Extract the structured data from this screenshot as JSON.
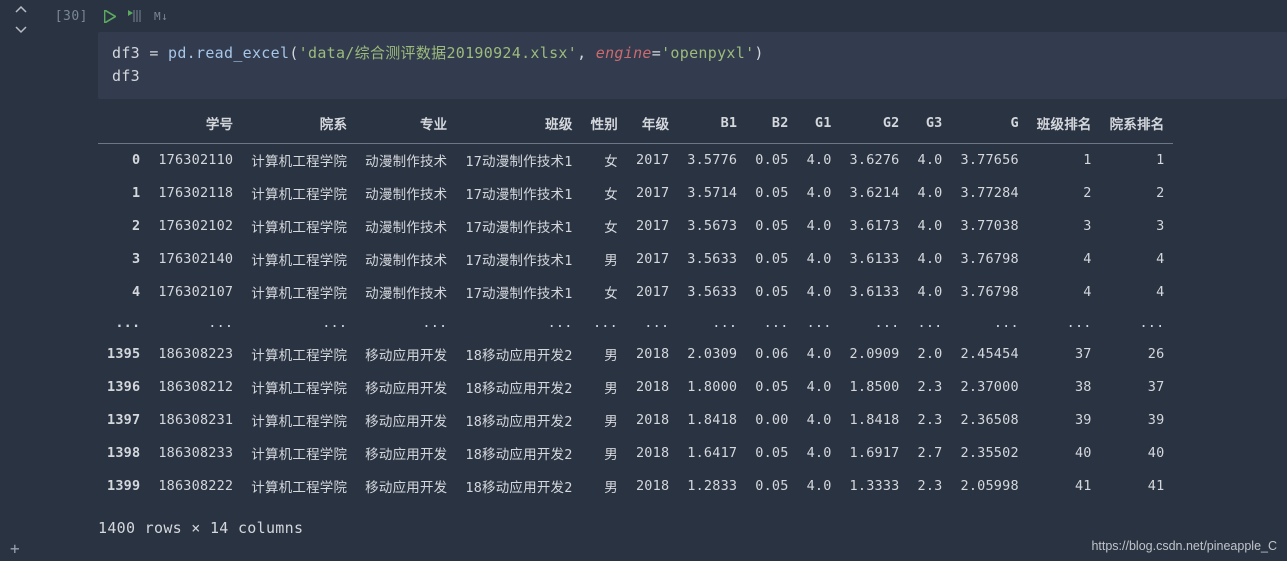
{
  "cell": {
    "exec_count": "[30]",
    "toolbar": {
      "run_title": "Run",
      "step_title": "Run line",
      "md_label": "M↓"
    },
    "code": {
      "line1": {
        "var": "df3",
        "assign": " = ",
        "call1": "pd.read_excel",
        "paren_open": "(",
        "str1": "'data/综合测评数据20190924.xlsx'",
        "comma": ", ",
        "kwarg": "engine",
        "eq": "=",
        "str2": "'openpyxl'",
        "paren_close": ")"
      },
      "line2": "df3"
    }
  },
  "dataframe": {
    "columns": [
      "学号",
      "院系",
      "专业",
      "班级",
      "性别",
      "年级",
      "B1",
      "B2",
      "G1",
      "G2",
      "G3",
      "G",
      "班级排名",
      "院系排名"
    ],
    "rows": [
      {
        "idx": "0",
        "vals": [
          "176302110",
          "计算机工程学院",
          "动漫制作技术",
          "17动漫制作技术1",
          "女",
          "2017",
          "3.5776",
          "0.05",
          "4.0",
          "3.6276",
          "4.0",
          "3.77656",
          "1",
          "1"
        ]
      },
      {
        "idx": "1",
        "vals": [
          "176302118",
          "计算机工程学院",
          "动漫制作技术",
          "17动漫制作技术1",
          "女",
          "2017",
          "3.5714",
          "0.05",
          "4.0",
          "3.6214",
          "4.0",
          "3.77284",
          "2",
          "2"
        ]
      },
      {
        "idx": "2",
        "vals": [
          "176302102",
          "计算机工程学院",
          "动漫制作技术",
          "17动漫制作技术1",
          "女",
          "2017",
          "3.5673",
          "0.05",
          "4.0",
          "3.6173",
          "4.0",
          "3.77038",
          "3",
          "3"
        ]
      },
      {
        "idx": "3",
        "vals": [
          "176302140",
          "计算机工程学院",
          "动漫制作技术",
          "17动漫制作技术1",
          "男",
          "2017",
          "3.5633",
          "0.05",
          "4.0",
          "3.6133",
          "4.0",
          "3.76798",
          "4",
          "4"
        ]
      },
      {
        "idx": "4",
        "vals": [
          "176302107",
          "计算机工程学院",
          "动漫制作技术",
          "17动漫制作技术1",
          "女",
          "2017",
          "3.5633",
          "0.05",
          "4.0",
          "3.6133",
          "4.0",
          "3.76798",
          "4",
          "4"
        ]
      },
      {
        "idx": "...",
        "vals": [
          "...",
          "...",
          "...",
          "...",
          "...",
          "...",
          "...",
          "...",
          "...",
          "...",
          "...",
          "...",
          "...",
          "..."
        ]
      },
      {
        "idx": "1395",
        "vals": [
          "186308223",
          "计算机工程学院",
          "移动应用开发",
          "18移动应用开发2",
          "男",
          "2018",
          "2.0309",
          "0.06",
          "4.0",
          "2.0909",
          "2.0",
          "2.45454",
          "37",
          "26"
        ]
      },
      {
        "idx": "1396",
        "vals": [
          "186308212",
          "计算机工程学院",
          "移动应用开发",
          "18移动应用开发2",
          "男",
          "2018",
          "1.8000",
          "0.05",
          "4.0",
          "1.8500",
          "2.3",
          "2.37000",
          "38",
          "37"
        ]
      },
      {
        "idx": "1397",
        "vals": [
          "186308231",
          "计算机工程学院",
          "移动应用开发",
          "18移动应用开发2",
          "男",
          "2018",
          "1.8418",
          "0.00",
          "4.0",
          "1.8418",
          "2.3",
          "2.36508",
          "39",
          "39"
        ]
      },
      {
        "idx": "1398",
        "vals": [
          "186308233",
          "计算机工程学院",
          "移动应用开发",
          "18移动应用开发2",
          "男",
          "2018",
          "1.6417",
          "0.05",
          "4.0",
          "1.6917",
          "2.7",
          "2.35502",
          "40",
          "40"
        ]
      },
      {
        "idx": "1399",
        "vals": [
          "186308222",
          "计算机工程学院",
          "移动应用开发",
          "18移动应用开发2",
          "男",
          "2018",
          "1.2833",
          "0.05",
          "4.0",
          "1.3333",
          "2.3",
          "2.05998",
          "41",
          "41"
        ]
      }
    ],
    "summary": "1400 rows × 14 columns"
  },
  "watermark": "https://blog.csdn.net/pineapple_C",
  "add_cell_glyph": "+"
}
